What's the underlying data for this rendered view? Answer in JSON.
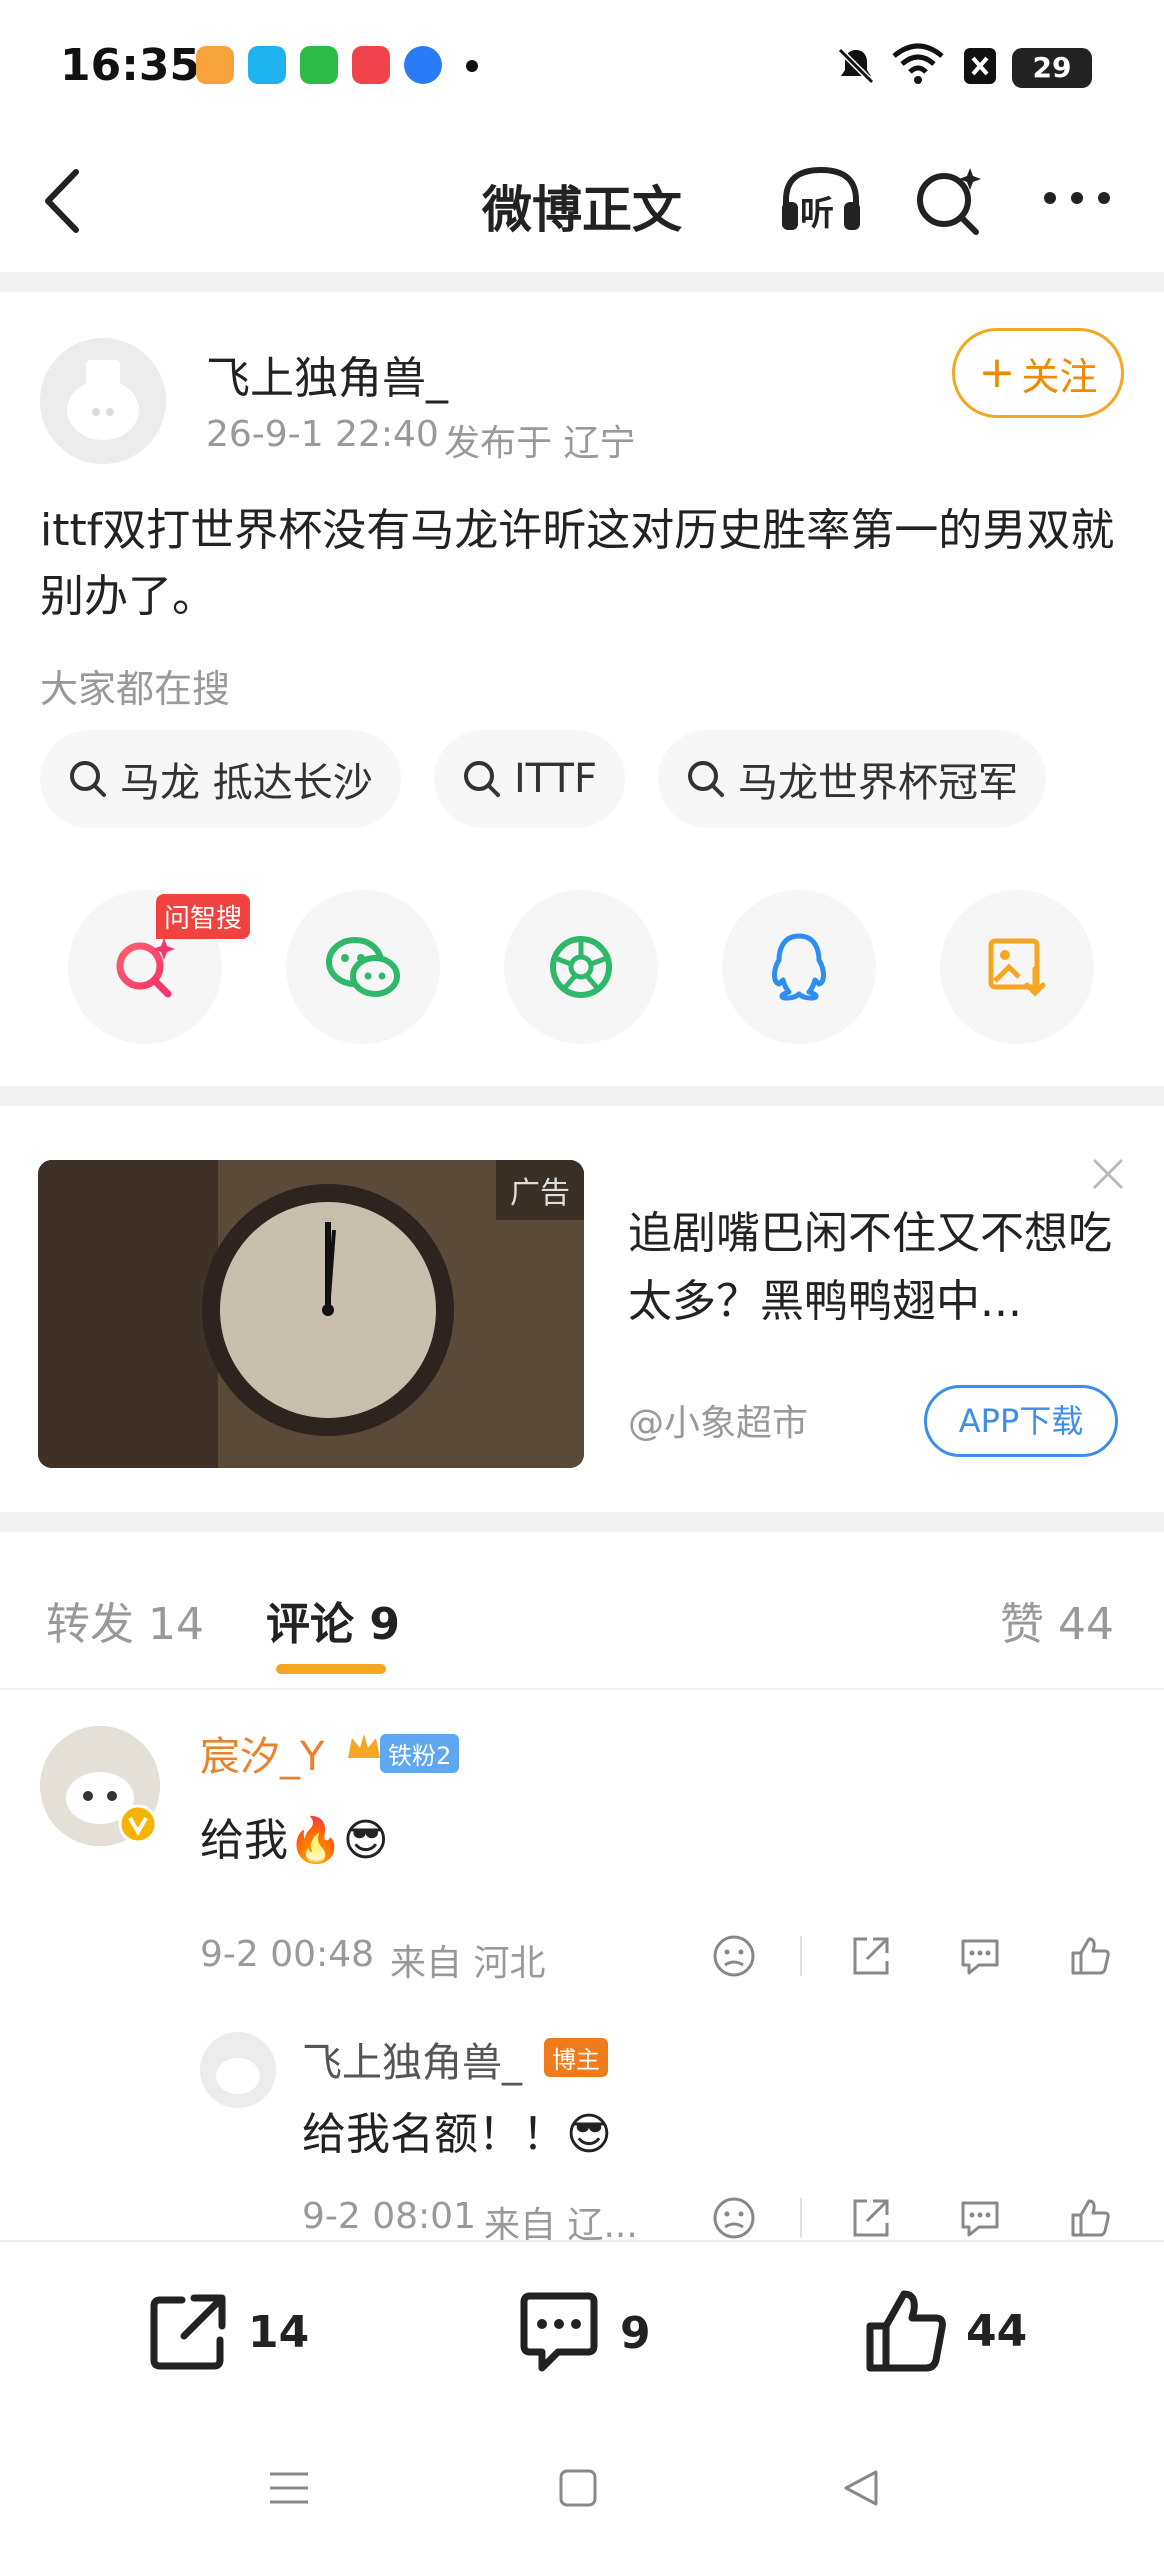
{
  "status_bar": {
    "time": "16:35",
    "battery": "29",
    "app_icons": [
      "#f6a33b",
      "#1fb2f0",
      "#2dbb47",
      "#f0434c",
      "#2a7bf5"
    ],
    "icons": [
      "mute-icon",
      "wifi-icon",
      "sim-icon",
      "battery-icon"
    ]
  },
  "nav": {
    "back_icon": "back-arrow-icon",
    "title": "微博正文",
    "listen_label": "听",
    "search_icon": "ai-search-icon",
    "more_icon": "more-icon"
  },
  "post": {
    "author": "飞上独角兽_",
    "time": "26-9-1 22:40",
    "location": "发布于 辽宁",
    "follow_label": "关注",
    "text": "ittf双打世界杯没有马龙许昕这对历史胜率第一的男双就别办了。",
    "search_heading": "大家都在搜",
    "search_chips": [
      "马龙 抵达长沙",
      "ITTF",
      "马龙世界杯冠军"
    ],
    "share_badge": "问智搜",
    "share_targets": [
      "wzs-search-icon",
      "wechat-icon",
      "moments-icon",
      "qq-icon",
      "save-image-icon"
    ]
  },
  "ad": {
    "tag": "广告",
    "title": "追剧嘴巴闲不住又不想吃太多？黑鸭鸭翅中...",
    "source": "@小象超市",
    "button": "APP下载"
  },
  "tabs": {
    "repost": "转发 14",
    "comments": "评论 9",
    "likes": "赞 44"
  },
  "comments": [
    {
      "name": "宸汐_Y",
      "badge": "铁粉2",
      "text": "给我🔥😎",
      "time": "9-2 00:48",
      "location": "来自 河北"
    },
    {
      "name": "飞上独角兽_",
      "badge": "博主",
      "text": "给我名额！！😎",
      "time": "9-2 08:01",
      "location": "来自 辽..."
    }
  ],
  "bottom": {
    "repost_count": "14",
    "comment_count": "9",
    "like_count": "44"
  },
  "colors": {
    "accent_orange": "#f5a623",
    "name_orange": "#e9832b",
    "link_blue": "#3c8ee8",
    "badge_red": "#f0433f"
  }
}
